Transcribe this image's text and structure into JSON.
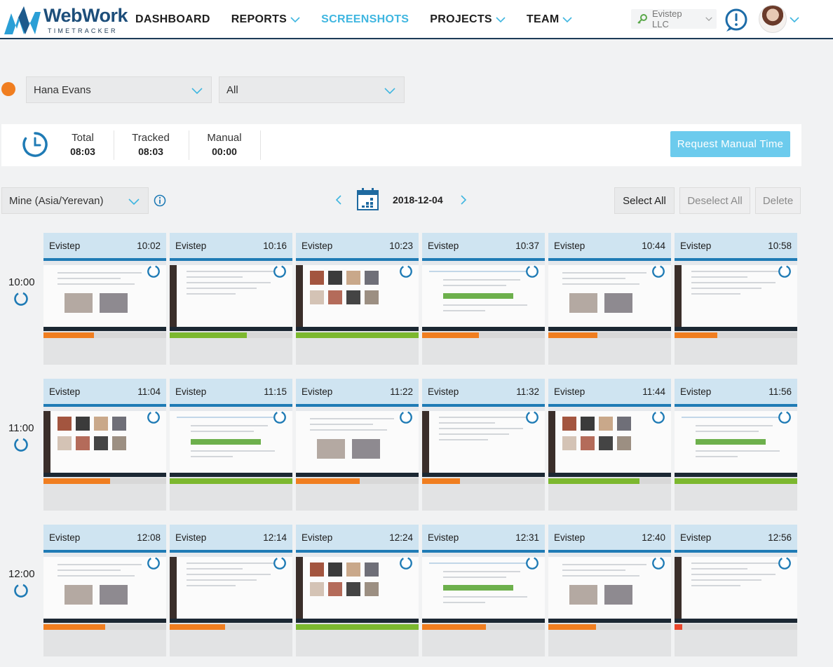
{
  "brand": {
    "name": "WebWork",
    "tagline": "TIMETRACKER"
  },
  "nav": {
    "items": [
      {
        "label": "DASHBOARD",
        "dropdown": false,
        "active": false
      },
      {
        "label": "REPORTS",
        "dropdown": true,
        "active": false
      },
      {
        "label": "SCREENSHOTS",
        "dropdown": false,
        "active": true
      },
      {
        "label": "PROJECTS",
        "dropdown": true,
        "active": false
      },
      {
        "label": "TEAM",
        "dropdown": true,
        "active": false
      }
    ],
    "company": "Evistep LLC"
  },
  "filters": {
    "user": "Hana Evans",
    "project": "All",
    "status_color": "#f07e20"
  },
  "totals": {
    "total_label": "Total",
    "total_value": "08:03",
    "tracked_label": "Tracked",
    "tracked_value": "08:03",
    "manual_label": "Manual",
    "manual_value": "00:00",
    "request_button": "Request Manual Time"
  },
  "toolbar": {
    "timezone": "Mine (Asia/Yerevan)",
    "date": "2018-12-04",
    "select_all": "Select All",
    "deselect_all": "Deselect All",
    "delete": "Delete"
  },
  "colors": {
    "accent": "#3fb6e0",
    "low_activity": "#f07e20",
    "high_activity": "#7cb82f",
    "very_low_activity": "#e8462c"
  },
  "hours": [
    {
      "label": "10:00",
      "shots": [
        {
          "project": "Evistep",
          "time": "10:02",
          "activity": 0.41,
          "level": "low"
        },
        {
          "project": "Evistep",
          "time": "10:16",
          "activity": 0.63,
          "level": "high"
        },
        {
          "project": "Evistep",
          "time": "10:23",
          "activity": 1.0,
          "level": "high"
        },
        {
          "project": "Evistep",
          "time": "10:37",
          "activity": 0.46,
          "level": "low"
        },
        {
          "project": "Evistep",
          "time": "10:44",
          "activity": 0.4,
          "level": "low"
        },
        {
          "project": "Evistep",
          "time": "10:58",
          "activity": 0.35,
          "level": "low"
        }
      ]
    },
    {
      "label": "11:00",
      "shots": [
        {
          "project": "Evistep",
          "time": "11:04",
          "activity": 0.54,
          "level": "low"
        },
        {
          "project": "Evistep",
          "time": "11:15",
          "activity": 1.0,
          "level": "high"
        },
        {
          "project": "Evistep",
          "time": "11:22",
          "activity": 0.52,
          "level": "low"
        },
        {
          "project": "Evistep",
          "time": "11:32",
          "activity": 0.31,
          "level": "low"
        },
        {
          "project": "Evistep",
          "time": "11:44",
          "activity": 0.74,
          "level": "high"
        },
        {
          "project": "Evistep",
          "time": "11:56",
          "activity": 1.0,
          "level": "high"
        }
      ]
    },
    {
      "label": "12:00",
      "shots": [
        {
          "project": "Evistep",
          "time": "12:08",
          "activity": 0.5,
          "level": "low"
        },
        {
          "project": "Evistep",
          "time": "12:14",
          "activity": 0.45,
          "level": "low"
        },
        {
          "project": "Evistep",
          "time": "12:24",
          "activity": 1.0,
          "level": "high"
        },
        {
          "project": "Evistep",
          "time": "12:31",
          "activity": 0.52,
          "level": "low"
        },
        {
          "project": "Evistep",
          "time": "12:40",
          "activity": 0.39,
          "level": "low"
        },
        {
          "project": "Evistep",
          "time": "12:56",
          "activity": 0.06,
          "level": "very_low"
        }
      ]
    }
  ]
}
